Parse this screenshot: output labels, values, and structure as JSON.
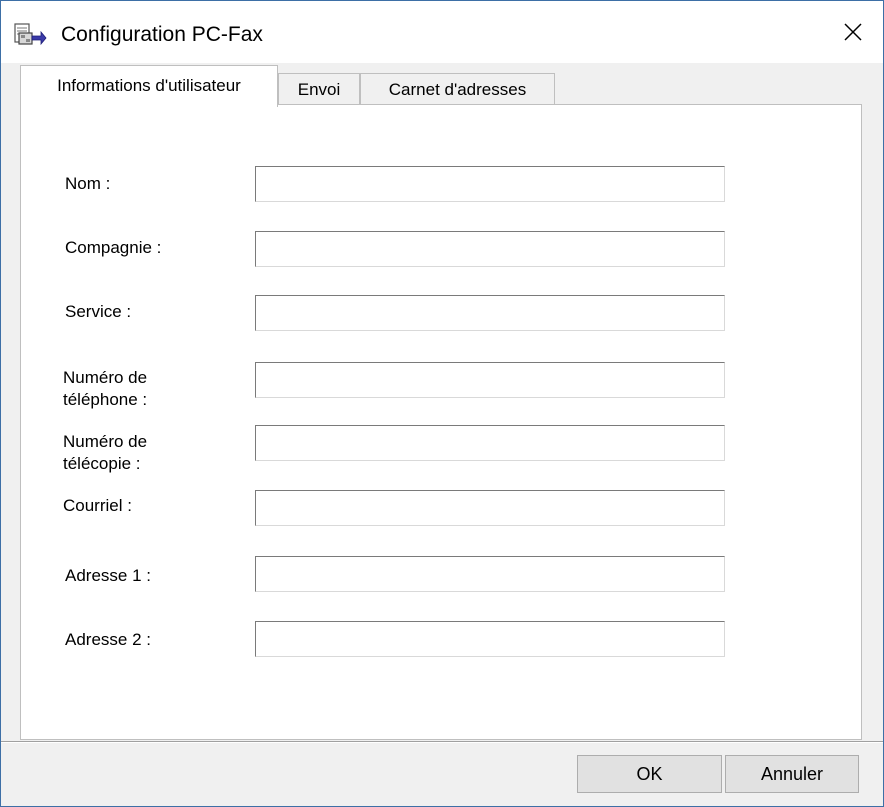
{
  "window": {
    "title": "Configuration PC-Fax",
    "close_glyph": "✕",
    "app_icon": "fax-icon"
  },
  "tabs": [
    {
      "label": "Informations d'utilisateur",
      "active": true
    },
    {
      "label": "Envoi",
      "active": false
    },
    {
      "label": "Carnet d'adresses",
      "active": false
    }
  ],
  "form": {
    "fields": [
      {
        "label": "Nom :",
        "value": ""
      },
      {
        "label": "Compagnie :",
        "value": ""
      },
      {
        "label": "Service :",
        "value": ""
      },
      {
        "label": "Numéro de\ntéléphone :",
        "value": ""
      },
      {
        "label": "Numéro de\ntélécopie :",
        "value": ""
      },
      {
        "label": "Courriel :",
        "value": ""
      },
      {
        "label": "Adresse 1 :",
        "value": ""
      },
      {
        "label": "Adresse 2 :",
        "value": ""
      }
    ]
  },
  "buttons": {
    "ok": "OK",
    "cancel": "Annuler"
  },
  "colors": {
    "window_border": "#3d6fa6",
    "dialog_bg": "#f0f0f0",
    "panel_bg": "#ffffff",
    "button_bg": "#e1e1e1"
  }
}
